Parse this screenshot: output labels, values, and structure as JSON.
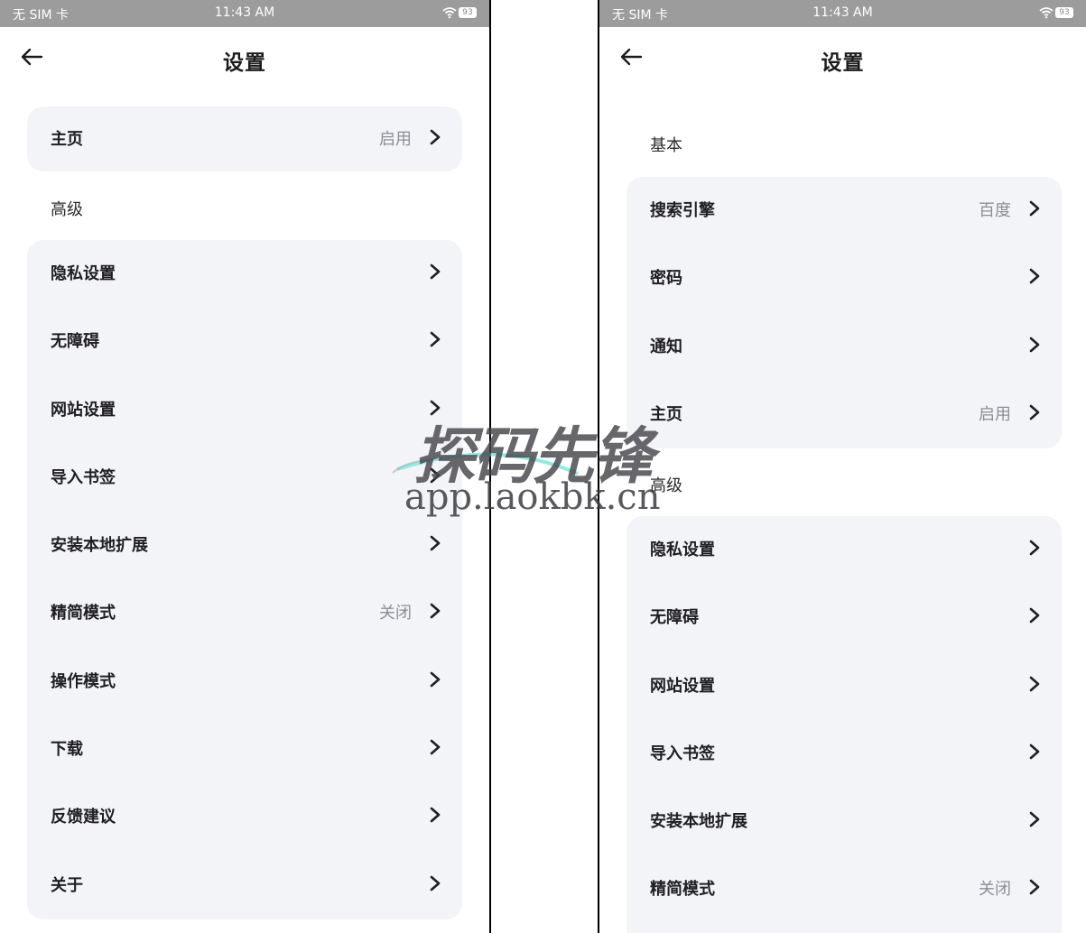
{
  "status_bar": {
    "carrier": "无 SIM 卡",
    "time": "11:43 AM",
    "battery": "93"
  },
  "left": {
    "title": "设置",
    "top_card": [
      {
        "label": "主页",
        "value": "启用"
      }
    ],
    "advanced_label": "高级",
    "advanced_items": [
      {
        "label": "隐私设置",
        "value": ""
      },
      {
        "label": "无障碍",
        "value": ""
      },
      {
        "label": "网站设置",
        "value": ""
      },
      {
        "label": "导入书签",
        "value": ""
      },
      {
        "label": "安装本地扩展",
        "value": ""
      },
      {
        "label": "精简模式",
        "value": "关闭"
      },
      {
        "label": "操作模式",
        "value": ""
      },
      {
        "label": "下载",
        "value": ""
      },
      {
        "label": "反馈建议",
        "value": ""
      },
      {
        "label": "关于",
        "value": ""
      }
    ]
  },
  "right": {
    "title": "设置",
    "basic_label": "基本",
    "basic_items": [
      {
        "label": "搜索引擎",
        "value": "百度"
      },
      {
        "label": "密码",
        "value": ""
      },
      {
        "label": "通知",
        "value": ""
      },
      {
        "label": "主页",
        "value": "启用"
      }
    ],
    "advanced_label": "高级",
    "advanced_items": [
      {
        "label": "隐私设置",
        "value": ""
      },
      {
        "label": "无障碍",
        "value": ""
      },
      {
        "label": "网站设置",
        "value": ""
      },
      {
        "label": "导入书签",
        "value": ""
      },
      {
        "label": "安装本地扩展",
        "value": ""
      },
      {
        "label": "精简模式",
        "value": "关闭"
      }
    ]
  },
  "watermark": {
    "brand": "探码先锋",
    "url": "app.laokbk.cn"
  },
  "icons": {
    "back": "back-arrow-icon",
    "chevron": "chevron-right-icon",
    "wifi": "wifi-icon",
    "battery": "battery-icon"
  },
  "colors": {
    "status_bar": "#9c9c9c",
    "card_bg": "#f3f4f8",
    "value_text": "#8d8d96",
    "page_bg": "#ffffff"
  }
}
